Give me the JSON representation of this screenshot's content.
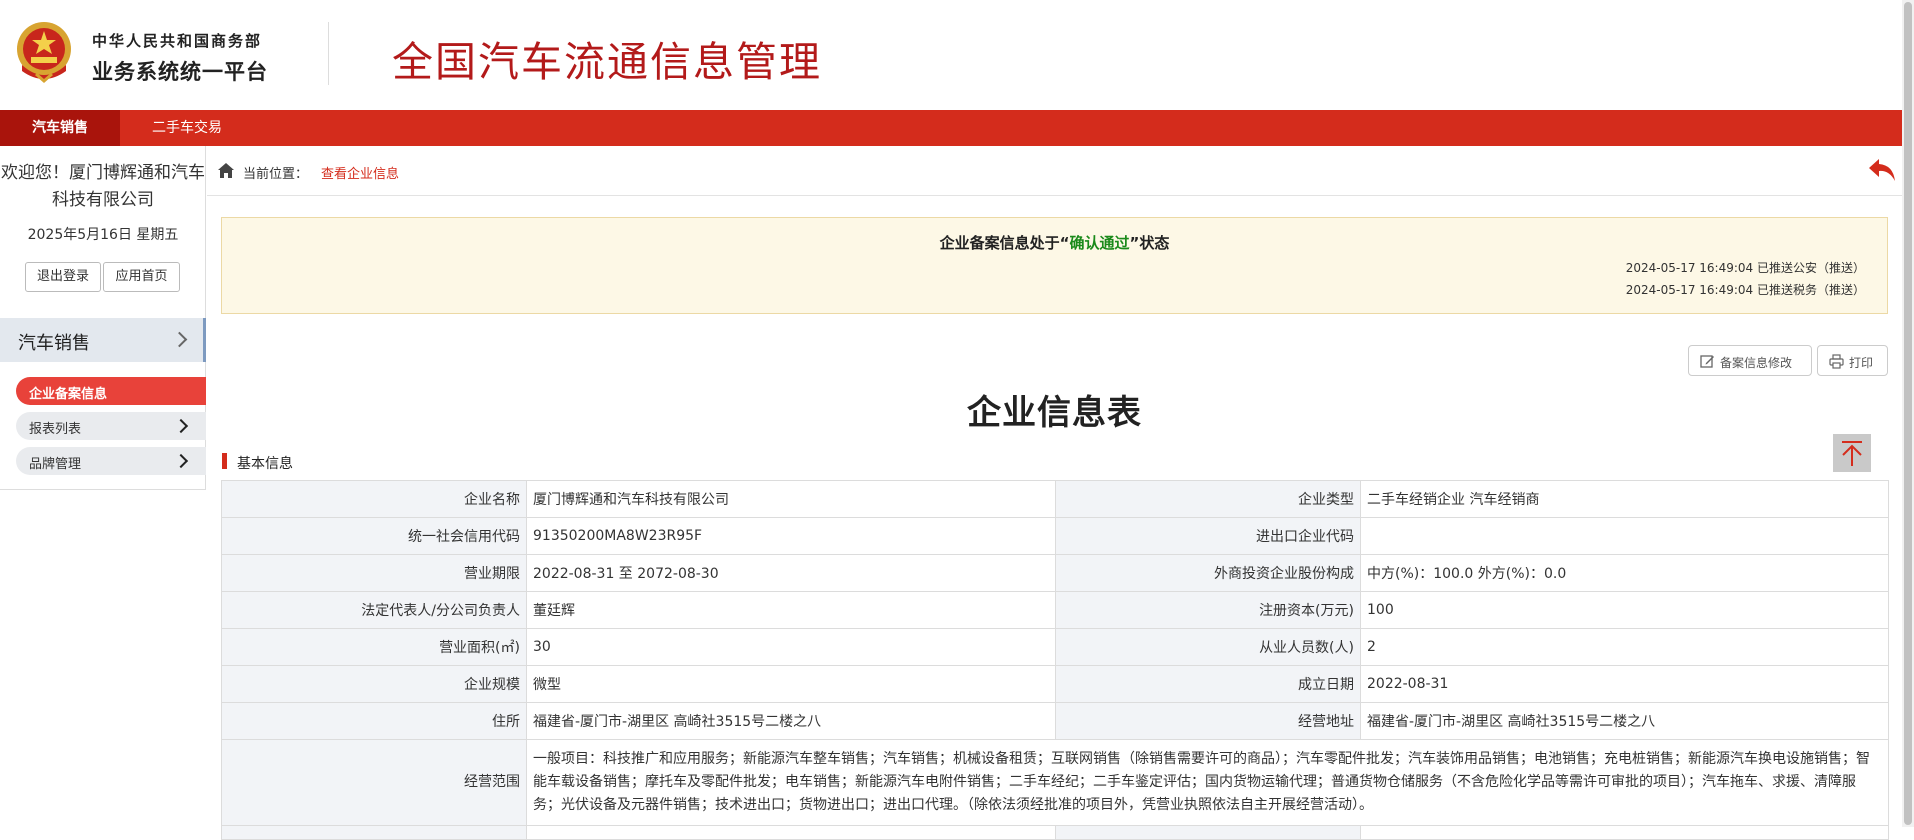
{
  "header": {
    "org_line1": "中华人民共和国商务部",
    "org_line2": "业务系统统一平台",
    "site_title": "全国汽车流通信息管理"
  },
  "nav": {
    "tabs": [
      {
        "label": "汽车销售",
        "active": true
      },
      {
        "label": "二手车交易",
        "active": false
      }
    ]
  },
  "sidebar": {
    "welcome": "欢迎您！厦门博辉通和汽车科技有限公司",
    "date": "2025年5月16日 星期五",
    "logout_label": "退出登录",
    "home_label": "应用首页",
    "menu_head": "汽车销售",
    "items": [
      {
        "label": "企业备案信息",
        "active": true
      },
      {
        "label": "报表列表",
        "active": false
      },
      {
        "label": "品牌管理",
        "active": false
      }
    ]
  },
  "breadcrumb": {
    "label": "当前位置：",
    "current": "查看企业信息"
  },
  "status": {
    "prefix": "企业备案信息处于“",
    "state": "确认通过",
    "suffix": "”状态",
    "logs": [
      "2024-05-17 16:49:04 已推送公安（推送）",
      "2024-05-17 16:49:04 已推送税务（推送）"
    ]
  },
  "actions": {
    "edit_label": "备案信息修改",
    "print_label": "打印"
  },
  "table_title": "企业信息表",
  "section_label": "基本信息",
  "info": {
    "company_name_key": "企业名称",
    "company_name": "厦门博辉通和汽车科技有限公司",
    "company_type_key": "企业类型",
    "company_type": "二手车经销企业 汽车经销商",
    "credit_code_key": "统一社会信用代码",
    "credit_code": "91350200MA8W23R95F",
    "import_code_key": "进出口企业代码",
    "import_code": "",
    "term_key": "营业期限",
    "term": "2022-08-31 至  2072-08-30",
    "foreign_key": "外商投资企业股份构成",
    "foreign": "中方(%)：100.0  外方(%)：0.0",
    "legal_key": "法定代表人/分公司负责人",
    "legal": "董廷辉",
    "capital_key": "注册资本(万元)",
    "capital": "100",
    "area_key": "营业面积(㎡)",
    "area": "30",
    "staff_key": "从业人员数(人)",
    "staff": "2",
    "scale_key": "企业规模",
    "scale": "微型",
    "founded_key": "成立日期",
    "founded": "2022-08-31",
    "address_key": "住所",
    "address": "福建省-厦门市-湖里区 高崎社3515号二楼之八",
    "biz_address_key": "经营地址",
    "biz_address": "福建省-厦门市-湖里区 高崎社3515号二楼之八",
    "scope_key": "经营范围",
    "scope": "一般项目：科技推广和应用服务；新能源汽车整车销售；汽车销售；机械设备租赁；互联网销售（除销售需要许可的商品）；汽车零配件批发；汽车装饰用品销售；电池销售；充电桩销售；新能源汽车换电设施销售；智能车载设备销售；摩托车及零配件批发；电车销售；新能源汽车电附件销售；二手车经纪；二手车鉴定评估；国内货物运输代理；普通货物仓储服务（不含危险化学品等需许可审批的项目）；汽车拖车、求援、清障服务；光伏设备及元器件销售；技术进出口；货物进出口；进出口代理。（除依法须经批准的项目外，凭营业执照依法自主开展经营活动）。"
  }
}
